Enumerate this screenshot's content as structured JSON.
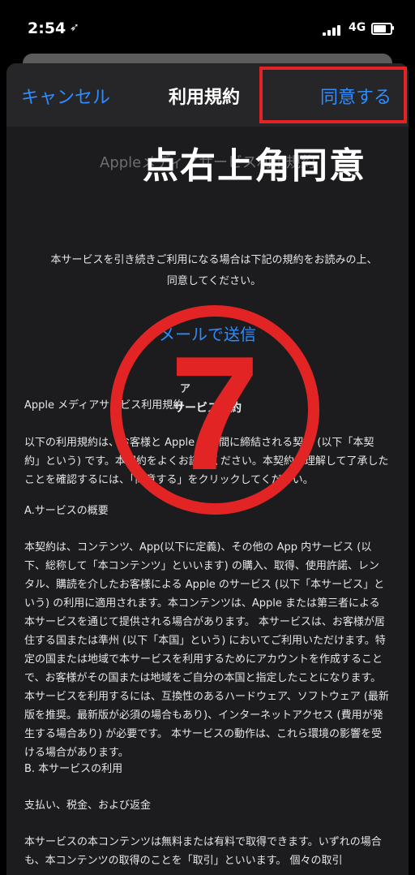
{
  "status_bar": {
    "time": "2:54",
    "location_icon": "location-arrow-icon",
    "network": "4G"
  },
  "nav": {
    "cancel_label": "キャンセル",
    "title": "利用規約",
    "agree_label": "同意する"
  },
  "annotation": {
    "overlay_text": "点右上角同意",
    "step_number": "7",
    "highlight_color": "#e32424"
  },
  "document": {
    "subtitle": "Appleメディアサービス利用規約",
    "intro": "本サービスを引き続きご利用になる場合は下記の規約をお読みの上、同意してください。",
    "email_link": "メールで送信",
    "faint_label": "ア",
    "section_heading": "サービス規約",
    "paragraphs": [
      "Apple メディアサービス利用規約",
      "以下の利用規約は、お客様と Apple との間に締結される契約 (以下「本契約」という) です。本契約をよくお読みください。本契約を理解して了承したことを確認するには、「同意する」をクリックしてください。",
      "A.サービスの概要",
      "本契約は、コンテンツ、App(以下に定義)、その他の App 内サービス (以下、総称して「本コンテンツ」といいます) の購入、取得、使用許諾、レンタル、購読を介したお客様による Apple のサービス (以下「本サービス」という) の利用に適用されます。本コンテンツは、Apple または第三者による本サービスを通じて提供される場合があります。 本サービスは、お客様が居住する国または準州 (以下「本国」という) においてご利用いただけます。特定の国または地域で本サービスを利用するためにアカウントを作成することで、お客様がその国または地域をご自分の本国と指定したことになります。 本サービスを利用するには、互換性のあるハードウェア、ソフトウェア (最新版を推奨。最新版が必須の場合もあり)、インターネットアクセス (費用が発生する場合あり) が必要です。 本サービスの動作は、これら環境の影響を受ける場合があります。",
      "B. 本サービスの利用",
      "支払い、税金、および返金",
      "本サービスの本コンテンツは無料または有料で取得できます。いずれの場合も、本コンテンツの取得のことを「取引」といいます。 個々の取引"
    ]
  }
}
